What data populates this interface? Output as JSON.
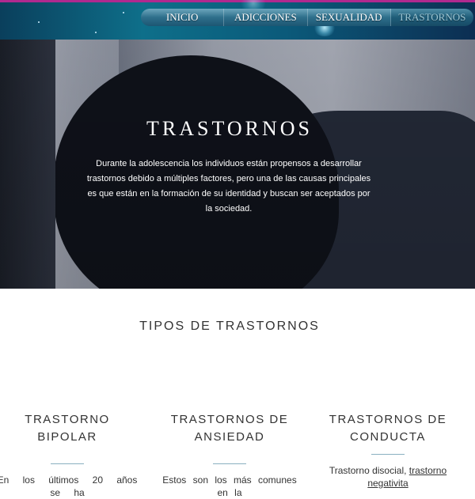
{
  "nav": {
    "items": [
      {
        "label": "INICIO"
      },
      {
        "label": "ADICCIONES"
      },
      {
        "label": "SEXUALIDAD"
      },
      {
        "label": "TRASTORNOS"
      }
    ],
    "active": "TRASTORNOS"
  },
  "hero": {
    "title": "TRASTORNOS",
    "description": "Durante la adolescencia los individuos están propensos a desarrollar trastornos debido a múltiples factores, pero una de las causas principales es que están en la formación de su identidad y buscan ser aceptados por la sociedad."
  },
  "section": {
    "title": "TIPOS DE TRASTORNOS",
    "columns": [
      {
        "title": "TRASTORNO BIPOLAR",
        "text": "En los últimos 20 años se ha"
      },
      {
        "title": "TRASTORNOS DE ANSIEDAD",
        "text": "Estos son los más comunes en la"
      },
      {
        "title_line1": "TRASTORNOS DE",
        "title_line2": "CONDUCTA",
        "text_prefix": "Trastorno disocial, ",
        "text_link": "trastorno negativita"
      }
    ]
  },
  "colors": {
    "header_band": "#0e6f8a",
    "accent_pink": "#b0298f",
    "text_dark": "#333333",
    "divider": "#8ab0c0"
  }
}
